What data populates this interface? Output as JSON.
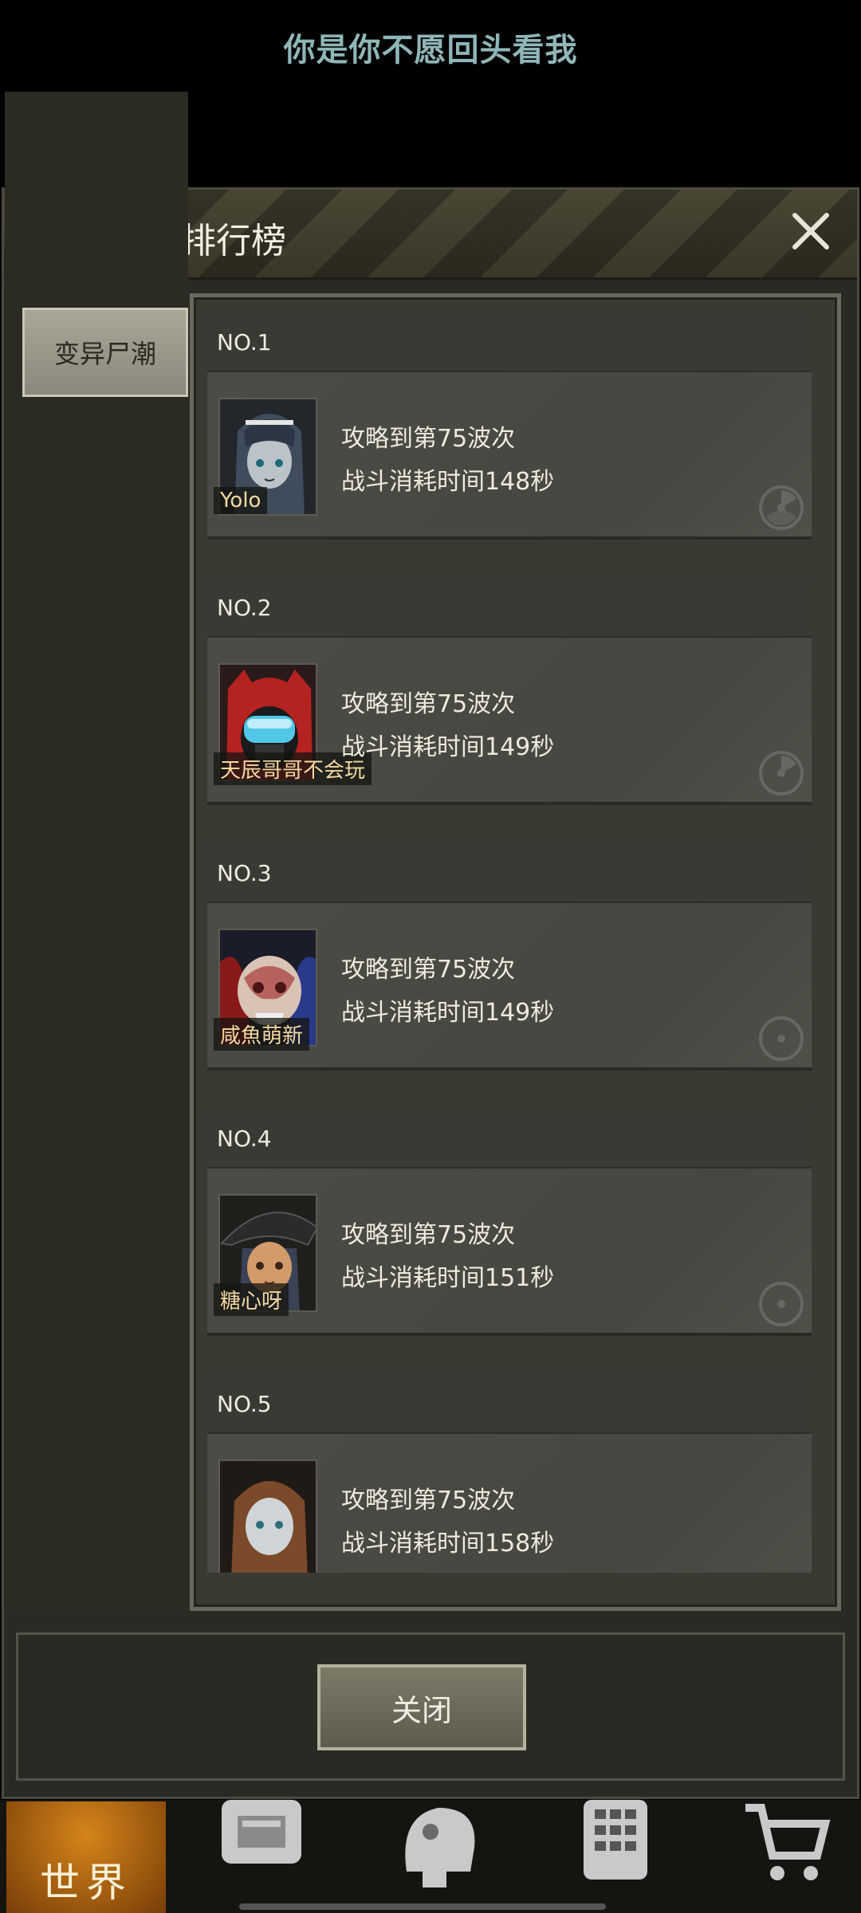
{
  "banner_text": "你是你不愿回头看我",
  "dialog": {
    "title": "变异尸潮排行榜",
    "tab_label": "变异尸潮",
    "close_button_label": "关闭"
  },
  "rankings": [
    {
      "rank": "NO.1",
      "name": "Yolo",
      "wave_text": "攻略到第75波次",
      "time_text": "战斗消耗时间148秒"
    },
    {
      "rank": "NO.2",
      "name": "天辰哥哥不会玩",
      "wave_text": "攻略到第75波次",
      "time_text": "战斗消耗时间149秒"
    },
    {
      "rank": "NO.3",
      "name": "咸魚萌新",
      "wave_text": "攻略到第75波次",
      "time_text": "战斗消耗时间149秒"
    },
    {
      "rank": "NO.4",
      "name": "糖心呀",
      "wave_text": "攻略到第75波次",
      "time_text": "战斗消耗时间151秒"
    },
    {
      "rank": "NO.5",
      "name": "",
      "wave_text": "攻略到第75波次",
      "time_text": "战斗消耗时间158秒"
    }
  ],
  "bottom_nav": {
    "world_label": "世界",
    "icons": [
      "backpack-icon",
      "head-icon",
      "phone-icon",
      "cart-icon"
    ]
  }
}
